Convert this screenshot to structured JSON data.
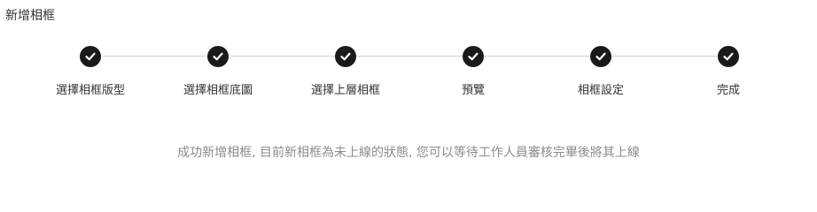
{
  "page": {
    "title": "新增相框"
  },
  "stepper": {
    "steps": [
      {
        "label": "選擇相框版型",
        "icon": "check-icon",
        "status": "completed"
      },
      {
        "label": "選擇相框底圖",
        "icon": "check-icon",
        "status": "completed"
      },
      {
        "label": "選擇上層相框",
        "icon": "check-icon",
        "status": "completed"
      },
      {
        "label": "預覽",
        "icon": "check-icon",
        "status": "completed"
      },
      {
        "label": "相框設定",
        "icon": "check-icon",
        "status": "completed"
      },
      {
        "label": "完成",
        "icon": "check-icon",
        "status": "completed"
      }
    ]
  },
  "message": {
    "text": "成功新增相框, 目前新相框為未上線的狀態, 您可以等待工作人員審核完畢後將其上線"
  },
  "colors": {
    "step_circle": "#1a1a1a",
    "connector": "#cfcfcf",
    "message_text": "#8c8c8c"
  }
}
